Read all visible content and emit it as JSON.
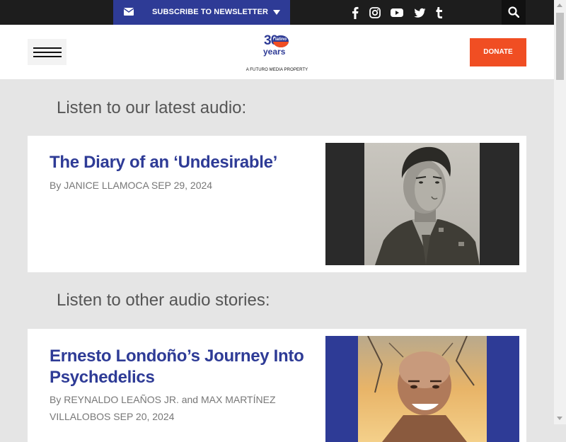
{
  "topbar": {
    "subscribe_label": "SUBSCRIBE TO NEWSLETTER",
    "social_icons": [
      "facebook-icon",
      "instagram-icon",
      "youtube-icon",
      "twitter-icon",
      "tumblr-icon"
    ],
    "colors": {
      "bar": "#1d1d1d",
      "subscribe_bg": "#2e3b96"
    }
  },
  "header": {
    "logo_number": "30",
    "logo_badge": "latino",
    "logo_years": "years",
    "tagline": "A FUTURO MEDIA PROPERTY",
    "donate_label": "DONATE",
    "colors": {
      "brand": "#2e3b96",
      "accent": "#f04e23"
    }
  },
  "sections": {
    "latest_heading": "Listen to our latest audio:",
    "other_heading": "Listen to other audio stories:"
  },
  "articles": [
    {
      "title": "The Diary of an ‘Undesirable’",
      "byline": "By JANICE LLAMOCA SEP 29, 2024"
    },
    {
      "title": "Ernesto Londoño’s Journey Into Psychedelics",
      "byline": "By REYNALDO LEAÑOS JR. and MAX MARTÍNEZ VILLALOBOS SEP 20, 2024"
    }
  ]
}
